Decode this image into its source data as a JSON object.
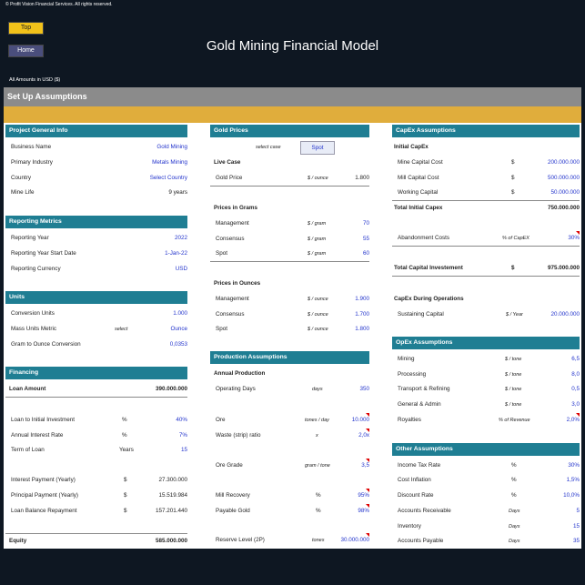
{
  "header": {
    "copyright": "© Profit Vision Financial Services. All rights reserved.",
    "top_button": "Top",
    "home_button": "Home",
    "title": "Gold Mining Financial Model",
    "amounts": "All Amounts in  USD ($)"
  },
  "setup": {
    "title": "Set Up Assumptions"
  },
  "project": {
    "header": "Project General Info",
    "rows": [
      {
        "label": "Business Name",
        "value": "Gold Mining"
      },
      {
        "label": "Primary Industry",
        "value": "Metals Mining"
      },
      {
        "label": "Country",
        "value": "Select Country"
      },
      {
        "label": "Mine Life",
        "value": "9 years"
      }
    ]
  },
  "reporting": {
    "header": "Reporting Metrics",
    "rows": [
      {
        "label": "Reporting Year",
        "value": "2022"
      },
      {
        "label": "Reporting Year Start Date",
        "value": "1-Jan-22"
      },
      {
        "label": "Reporting Currency",
        "value": "USD"
      }
    ]
  },
  "units": {
    "header": "Units",
    "rows": [
      {
        "label": "Conversion Units",
        "unit": "",
        "value": "1.000"
      },
      {
        "label": "Mass Units Metric",
        "unit": "select",
        "value": "Ounce"
      },
      {
        "label": "Gram to Ounce Conversion",
        "unit": "",
        "value": "0,0353"
      }
    ]
  },
  "financing": {
    "header": "Financing",
    "loan_label": "Loan Amount",
    "loan_value": "390.000.000",
    "rows": [
      {
        "label": "Loan to Initial Investment",
        "unit": "%",
        "value": "40%"
      },
      {
        "label": "Annual Interest Rate",
        "unit": "%",
        "value": "7%"
      },
      {
        "label": "Term of Loan",
        "unit": "Years",
        "value": "15"
      },
      {
        "label": "Interest Payment (Yearly)",
        "unit": "$",
        "value": "27.300.000"
      },
      {
        "label": "Principal Payment (Yearly)",
        "unit": "$",
        "value": "15.519.984"
      },
      {
        "label": "Loan Balance Repayment",
        "unit": "$",
        "value": "157.201.440"
      }
    ],
    "equity_label": "Equity",
    "equity_value": "585.000.000"
  },
  "gold_prices": {
    "header": "Gold Prices",
    "select_case_label": "select case",
    "select_case_value": "Spot",
    "live_case": "Live Case",
    "gold_price_label": "Gold Price",
    "gold_price_unit": "$ / ounce",
    "gold_price_value": "1.800",
    "grams_header": "Prices in Grams",
    "grams": [
      {
        "label": "Management",
        "unit": "$ / gram",
        "value": "70"
      },
      {
        "label": "Consensus",
        "unit": "$ / gram",
        "value": "55"
      },
      {
        "label": "Spot",
        "unit": "$ / gram",
        "value": "60"
      }
    ],
    "ounces_header": "Prices in Ounces",
    "ounces": [
      {
        "label": "Management",
        "unit": "$ / ounce",
        "value": "1.900"
      },
      {
        "label": "Consensus",
        "unit": "$ / ounce",
        "value": "1.700"
      },
      {
        "label": "Spot",
        "unit": "$ / ounce",
        "value": "1.800"
      }
    ]
  },
  "production": {
    "header": "Production Assumptions",
    "sub": "Annual Production",
    "rows": [
      {
        "label": "Operating Days",
        "unit": "days",
        "value": "350"
      },
      {
        "label": "Ore",
        "unit": "tones / day",
        "value": "10.000"
      },
      {
        "label": "Waste (strip) ratio",
        "unit": "x",
        "value": "2,0x"
      },
      {
        "label": "Ore Grade",
        "unit": "gram / tone",
        "value": "3,5"
      },
      {
        "label": "Mill Recovery",
        "unit": "%",
        "value": "95%"
      },
      {
        "label": "Payable Gold",
        "unit": "%",
        "value": "98%"
      },
      {
        "label": "Reserve Level (2P)",
        "unit": "tones",
        "value": "30.000.000"
      }
    ]
  },
  "capex": {
    "header": "CapEx Assumptions",
    "initial_header": "Initial CapEx",
    "rows": [
      {
        "label": "Mine Capital Cost",
        "unit": "$",
        "value": "200.000.000"
      },
      {
        "label": "Mill Capital Cost",
        "unit": "$",
        "value": "500.000.000"
      },
      {
        "label": "Working Capital",
        "unit": "$",
        "value": "50.000.000"
      }
    ],
    "total_initial_label": "Total Initial Capex",
    "total_initial_value": "750.000.000",
    "abandon_label": "Abandonment Costs",
    "abandon_unit": "% of CapEX",
    "abandon_value": "30%",
    "total_label": "Total Capital Investement",
    "total_unit": "$",
    "total_value": "975.000.000",
    "during_header": "CapEx During Operations",
    "sustaining_label": "Sustaining Capital",
    "sustaining_unit": "$ / Year",
    "sustaining_value": "20.000.000"
  },
  "opex": {
    "header": "OpEx Assumptions",
    "rows": [
      {
        "label": "Mining",
        "unit": "$ / tone",
        "value": "6,5"
      },
      {
        "label": "Processing",
        "unit": "$ / tone",
        "value": "8,0"
      },
      {
        "label": "Transport & Refining",
        "unit": "$ / tone",
        "value": "0,5"
      },
      {
        "label": "General & Admin",
        "unit": "$ / tone",
        "value": "3,0"
      },
      {
        "label": "Royalties",
        "unit": "% of Revenue",
        "value": "2,0%"
      }
    ]
  },
  "other": {
    "header": "Other Assumptions",
    "rows": [
      {
        "label": "Income Tax Rate",
        "unit": "%",
        "value": "30%"
      },
      {
        "label": "Cost Inflation",
        "unit": "%",
        "value": "1,5%"
      },
      {
        "label": "Discount Rate",
        "unit": "%",
        "value": "10,0%"
      },
      {
        "label": "Accounts Receivable",
        "unit": "Days",
        "value": "5"
      },
      {
        "label": "Inventory",
        "unit": "Days",
        "value": "15"
      },
      {
        "label": "Accounts Payable",
        "unit": "Days",
        "value": "35"
      }
    ]
  }
}
